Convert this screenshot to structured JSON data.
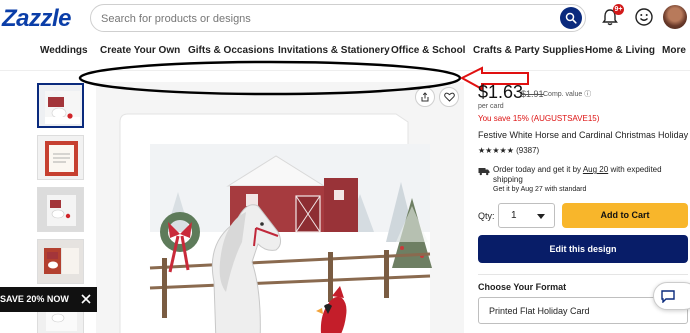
{
  "header": {
    "logo": "Zazzle",
    "search_placeholder": "Search for products or designs",
    "notification_badge": "9+"
  },
  "nav": {
    "items": [
      "Weddings",
      "Create Your Own",
      "Gifts & Occasions",
      "Invitations & Stationery",
      "Office & School",
      "Crafts & Party Supplies",
      "Home & Living",
      "More"
    ]
  },
  "product": {
    "price": "$1.63",
    "old_price": "$1.91",
    "comp_value": "Comp. value",
    "per_card": "per card",
    "saving": "You save 15% (AUGUSTSAVE15)",
    "title": "Festive White Horse and Cardinal Christmas Holiday",
    "rating": "★★★★★ (9387)",
    "shipping_line1_prefix": "Order today and get it by",
    "shipping_date": "Aug 20",
    "shipping_line1_suffix": "with expedited shipping",
    "shipping_line2": "Get it by Aug 27 with standard",
    "qty_label": "Qty:",
    "qty_value": "1",
    "add_to_cart": "Add to Cart",
    "edit_design": "Edit this design",
    "format_heading": "Choose Your Format",
    "format_value": "Printed Flat Holiday Card"
  },
  "promo": {
    "text": "SAVE 20% NOW"
  },
  "colors": {
    "brand_blue": "#0b3ea8",
    "dark_navy": "#081d68",
    "cart_yellow": "#f8b62b",
    "saving_red": "#d11111",
    "annotation_red": "#e01010"
  },
  "icons": [
    "search-icon",
    "bell-icon",
    "smiley-icon",
    "share-icon",
    "heart-icon",
    "truck-icon",
    "chevron-down-icon",
    "close-icon",
    "chat-icon"
  ]
}
